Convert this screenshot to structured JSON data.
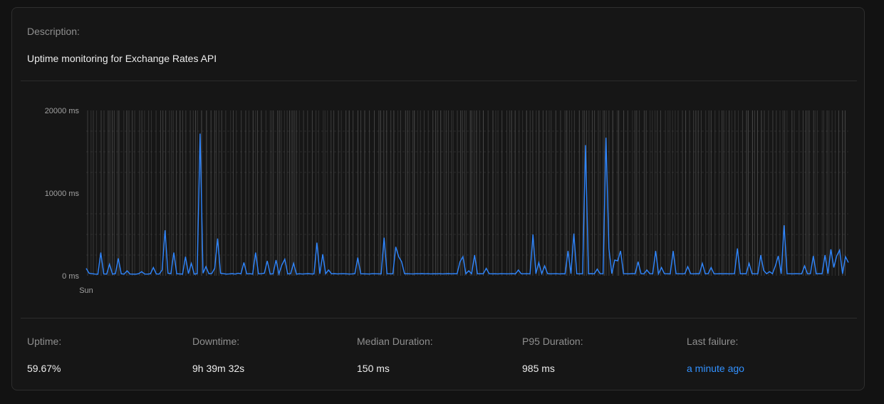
{
  "description": {
    "label": "Description",
    "text": "Uptime monitoring for Exchange Rates API"
  },
  "stats": {
    "uptime": {
      "label": "Uptime",
      "value": "59.67%"
    },
    "downtime": {
      "label": "Downtime",
      "value": "9h 39m 32s"
    },
    "median": {
      "label": "Median Duration",
      "value": "150 ms"
    },
    "p95": {
      "label": "P95 Duration",
      "value": "985 ms"
    },
    "last_failure": {
      "label": "Last failure",
      "value": "a minute ago"
    }
  },
  "colors": {
    "line": "#2f86ff",
    "failure": "#5a5a5a",
    "link": "#3291ff"
  },
  "chart_data": {
    "type": "line",
    "title": "",
    "xlabel": "",
    "ylabel": "",
    "x_tick_labels": [
      "Sun"
    ],
    "y_ticks": [
      0,
      10000,
      20000
    ],
    "y_tick_labels": [
      "0 ms",
      "10000 ms",
      "20000 ms"
    ],
    "ylim": [
      0,
      20000
    ],
    "grid": false,
    "series": [
      {
        "values": [
          900,
          300,
          250,
          200,
          180,
          2800,
          220,
          200,
          1400,
          200,
          250,
          2100,
          230,
          200,
          600,
          210,
          200,
          190,
          250,
          500,
          210,
          200,
          240,
          1000,
          220,
          200,
          700,
          5500,
          300,
          250,
          2800,
          240,
          220,
          200,
          2300,
          250,
          1500,
          200,
          250,
          17200,
          300,
          1100,
          250,
          280,
          900,
          4500,
          300,
          250,
          200,
          220,
          260,
          200,
          300,
          240,
          1600,
          220,
          250,
          200,
          2800,
          220,
          250,
          300,
          1800,
          210,
          240,
          1900,
          230,
          1300,
          2000,
          220,
          250,
          1500,
          200,
          240,
          210,
          230,
          260,
          220,
          220,
          4000,
          230,
          2600,
          250,
          700,
          230,
          260,
          220,
          240,
          250,
          230,
          210,
          220,
          250,
          2200,
          240,
          230,
          220,
          210,
          250,
          240,
          230,
          220,
          4600,
          250,
          240,
          230,
          3500,
          2300,
          1700,
          240,
          250,
          230,
          220,
          250,
          240,
          260,
          230,
          250,
          220,
          240,
          230,
          250,
          220,
          240,
          260,
          230,
          250,
          240,
          1700,
          2300,
          240,
          600,
          250,
          2500,
          230,
          250,
          240,
          900,
          250,
          230,
          240,
          220,
          250,
          240,
          230,
          240,
          260,
          220,
          700,
          230,
          240,
          250,
          220,
          5000,
          240,
          1600,
          250,
          1200,
          260,
          230,
          240,
          250,
          220,
          240,
          230,
          3000,
          250,
          5100,
          240,
          230,
          250,
          15800,
          240,
          260,
          230,
          800,
          250,
          240,
          16700,
          3300,
          250,
          1900,
          1800,
          3000,
          250,
          240,
          230,
          260,
          250,
          1700,
          240,
          230,
          700,
          250,
          240,
          3000,
          230,
          1000,
          250,
          240,
          220,
          3000,
          250,
          240,
          230,
          250,
          1100,
          240,
          230,
          250,
          240,
          1500,
          230,
          250,
          1000,
          240,
          230,
          250,
          240,
          250,
          230,
          240,
          250,
          3300,
          230,
          250,
          240,
          1500,
          250,
          230,
          240,
          2500,
          650,
          240,
          500,
          250,
          1200,
          2400,
          230,
          6100,
          250,
          240,
          230,
          250,
          240,
          230,
          1200,
          240,
          250,
          2400,
          230,
          250,
          240,
          2500,
          260,
          3200,
          1000,
          2400,
          3100,
          240,
          2300,
          1600
        ]
      }
    ],
    "failure_markers": "dense vertical gray bands across the whole time range"
  }
}
